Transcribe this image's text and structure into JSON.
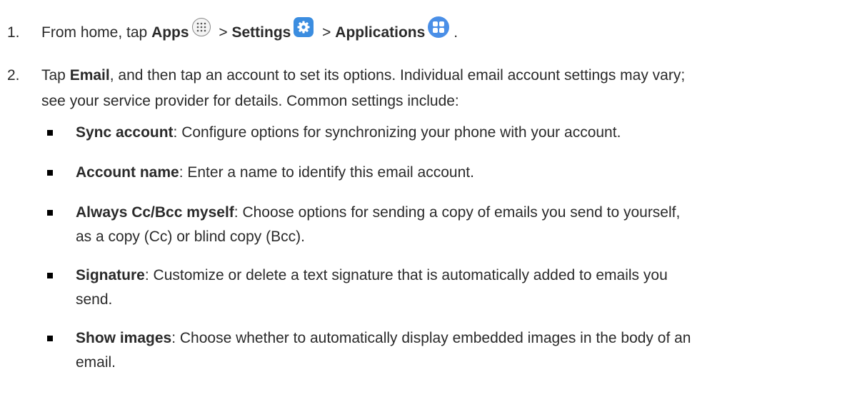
{
  "steps": [
    {
      "number": "1.",
      "prefix": "From home, tap ",
      "apps": "Apps",
      "sep1": " > ",
      "settings": "Settings",
      "sep2": " > ",
      "applications": "Applications",
      "suffix": "."
    },
    {
      "number": "2.",
      "prefix": "Tap ",
      "email": "Email",
      "text_line1": ", and then tap an account to set its options. Individual email account settings may vary;",
      "text_line2": "see your service provider for details. Common settings include:"
    }
  ],
  "bullets": [
    {
      "term": "Sync account",
      "lines": [
        ": Configure options for synchronizing your phone with your account."
      ]
    },
    {
      "term": "Account name",
      "lines": [
        ": Enter a name to identify this email account."
      ]
    },
    {
      "term": "Always Cc/Bcc myself",
      "lines": [
        ": Choose options for sending a copy of emails you send to yourself,",
        "as a copy (Cc) or blind copy (Bcc)."
      ]
    },
    {
      "term": "Signature",
      "lines": [
        ": Customize or delete a text signature that is automatically added to emails you",
        "send."
      ]
    },
    {
      "term": "Show images",
      "lines": [
        ": Choose whether to automatically display embedded images in the body of an",
        "email."
      ]
    }
  ],
  "icons": {
    "apps": "apps-grid-icon",
    "settings": "gear-icon",
    "applications": "applications-icon"
  },
  "colors": {
    "text": "#2a2a2a",
    "settings_icon": "#3b8de0",
    "applications_icon": "#4a8fe7"
  }
}
